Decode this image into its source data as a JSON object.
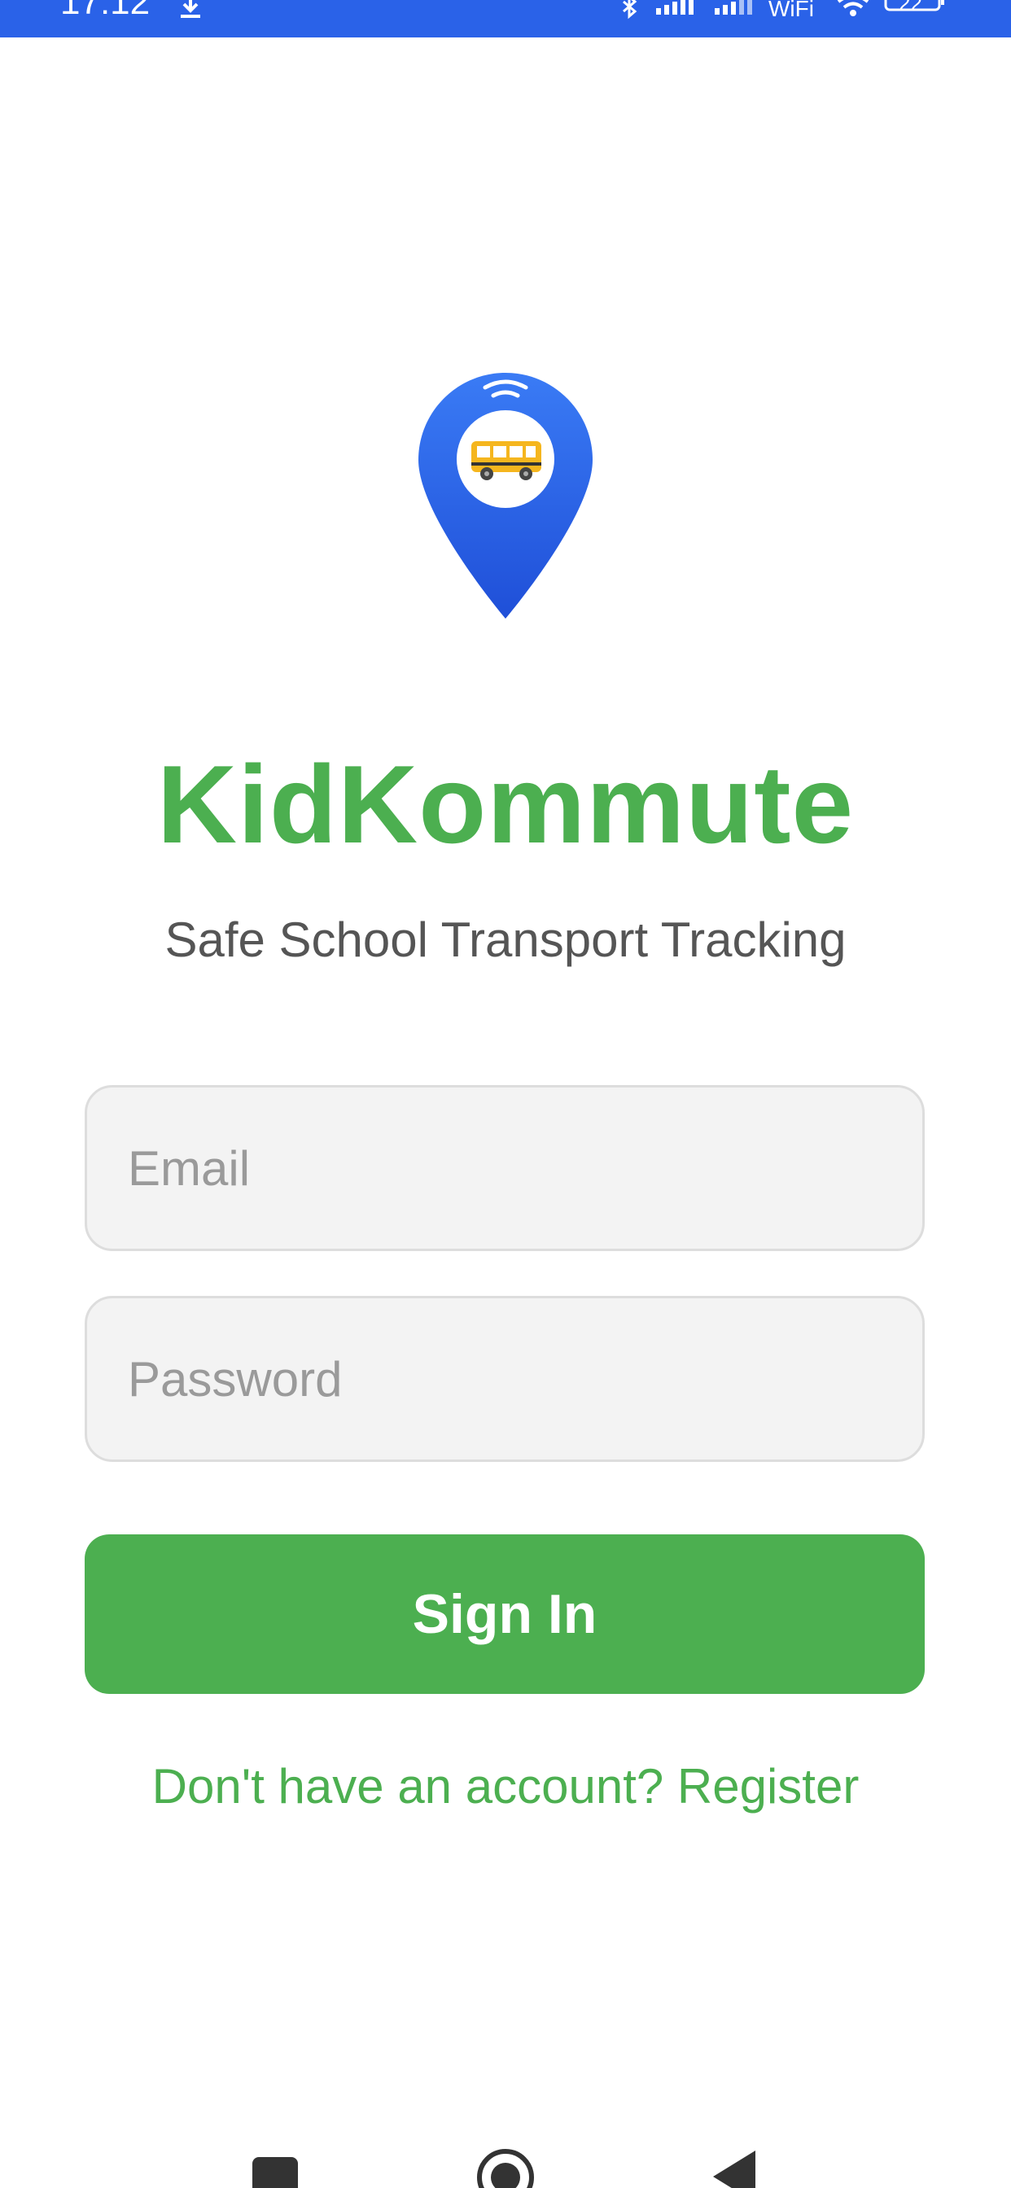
{
  "status_bar": {
    "time": "17:12",
    "wifi_label": "WiFi",
    "battery_level": "22",
    "icons": [
      "download-icon",
      "bluetooth-icon",
      "signal-icon",
      "signal-icon",
      "wifi-icon",
      "battery-icon"
    ]
  },
  "app": {
    "logo_icon": "bus-location-pin-icon",
    "title": "KidKommute",
    "subtitle": "Safe School Transport Tracking"
  },
  "form": {
    "email_placeholder": "Email",
    "email_value": "",
    "password_placeholder": "Password",
    "password_value": "",
    "sign_in_label": "Sign In",
    "register_link": "Don't have an account? Register"
  },
  "nav_bar": {
    "icons": [
      "recents-icon",
      "home-icon",
      "back-icon"
    ]
  },
  "colors": {
    "status_bar": "#2a62e8",
    "brand_green": "#4caf50",
    "pin_blue": "#2f6df0",
    "subtitle": "#555555"
  }
}
